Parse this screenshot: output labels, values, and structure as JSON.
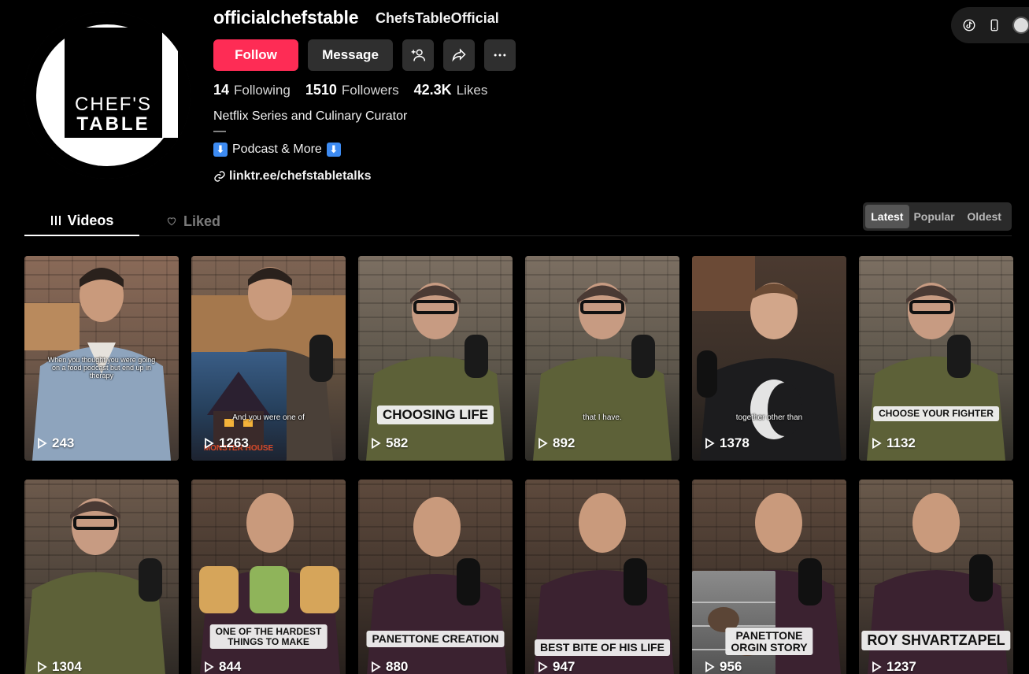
{
  "profile": {
    "username": "officialchefstable",
    "nickname": "ChefsTableOfficial",
    "avatar_text_line1": "CHEF'S",
    "avatar_text_line2": "TABLE",
    "follow_label": "Follow",
    "message_label": "Message",
    "stats": [
      {
        "value": "14",
        "label": "Following"
      },
      {
        "value": "1510",
        "label": "Followers"
      },
      {
        "value": "42.3K",
        "label": "Likes"
      }
    ],
    "bio_line1": "Netflix Series and Culinary Curator",
    "bio_line2": "—",
    "bio_line3": "Podcast & More",
    "emoji_down": "⬇",
    "link": "linktr.ee/chefstabletalks"
  },
  "tabs": {
    "videos": "Videos",
    "liked": "Liked"
  },
  "sort": {
    "latest": "Latest",
    "popular": "Popular",
    "oldest": "Oldest"
  },
  "videos": [
    {
      "views": "243",
      "subtitle": "When you thought you were going on a food podcast but end up in therapy",
      "caption": ""
    },
    {
      "views": "1263",
      "subtitle": "And you were one of",
      "caption": "",
      "inset_title": "MONSTER HOUSE"
    },
    {
      "views": "582",
      "subtitle": "",
      "caption": "CHOOSING LIFE"
    },
    {
      "views": "892",
      "subtitle": "that I have.",
      "caption": ""
    },
    {
      "views": "1378",
      "subtitle": "together other than",
      "caption": ""
    },
    {
      "views": "1132",
      "subtitle": "",
      "caption": "CHOOSE YOUR FIGHTER"
    },
    {
      "views": "1304",
      "subtitle": "",
      "caption": ""
    },
    {
      "views": "844",
      "subtitle": "",
      "caption": "ONE OF THE HARDEST\nTHINGS TO MAKE"
    },
    {
      "views": "880",
      "subtitle": "",
      "caption": "PANETTONE CREATION"
    },
    {
      "views": "947",
      "subtitle": "",
      "caption": "BEST BITE OF HIS LIFE"
    },
    {
      "views": "956",
      "subtitle": "",
      "caption": "PANETTONE\nORGIN STORY"
    },
    {
      "views": "1237",
      "subtitle": "",
      "caption": "ROY SHVARTZAPEL"
    }
  ],
  "colors": {
    "accent": "#fe2c55",
    "button_dark": "#2f2f2f"
  }
}
